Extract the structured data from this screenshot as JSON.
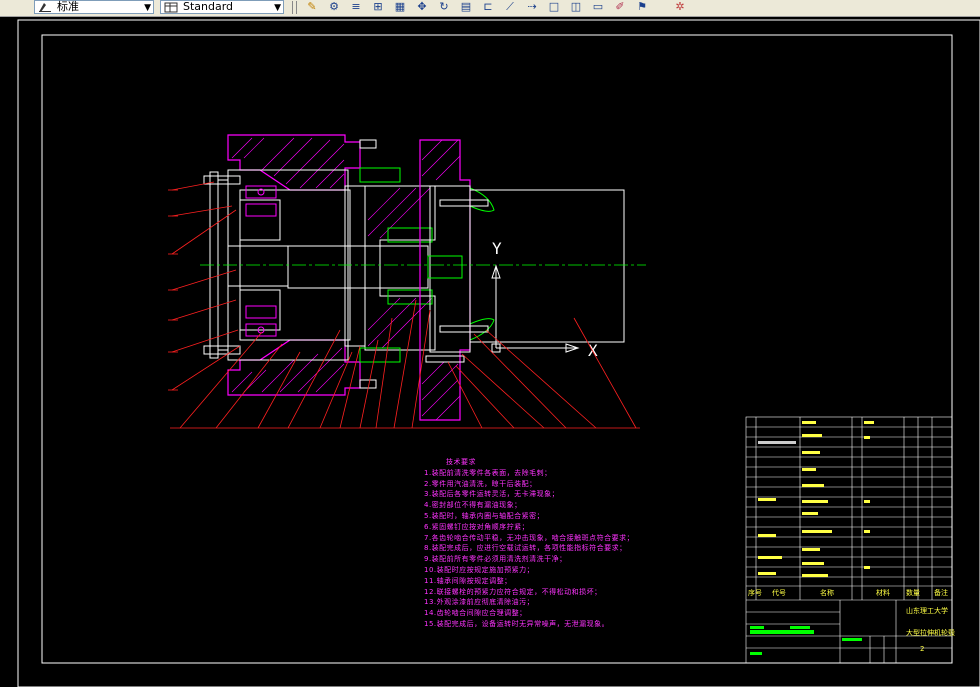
{
  "toolbar": {
    "style_combo": {
      "value": "标准"
    },
    "table_style_combo": {
      "value": "Standard"
    },
    "tools": [
      "pencil-icon",
      "node-icon",
      "layer-icon",
      "grid-icon",
      "move-icon",
      "rotate-icon",
      "table-icon",
      "dim-icon",
      "dim-icon",
      "rect-icon",
      "rect-icon",
      "edit-icon",
      "flag-icon",
      "explode-icon"
    ]
  },
  "drawing": {
    "axis_y_label": "Y",
    "axis_x_label": "X",
    "tech_requirements_title": "技术要求",
    "tech_requirements": [
      "1.装配前清洗零件各表面，去除毛刺；",
      "2.零件用汽油清洗，晾干后装配；",
      "3.装配后各零件运转灵活，无卡滞现象；",
      "4.密封部位不得有漏油现象；",
      "5.装配时，轴承内圈与轴配合紧密；",
      "6.紧固螺钉应按对角顺序拧紧；",
      "7.各齿轮啮合传动平稳，无冲击现象，啮合接触斑点符合要求；",
      "8.装配完成后，应进行空载试运转，各项性能指标符合要求；",
      "9.装配前所有零件必须用清洗剂清洗干净；",
      "10.装配时应按规定施加预紧力；",
      "11.轴承间隙按规定调整；",
      "12.联接螺栓的预紧力应符合规定，不得松动和损坏；",
      "13.外观涂漆前应彻底清除油污；",
      "14.齿轮啮合间隙应合理调整；",
      "15.装配完成后，设备运转时无异常噪声，无泄漏现象。"
    ],
    "title_block": {
      "school": "山东理工大学",
      "drawing_name": "大型拉伸机轮毂",
      "sheet_no": "2",
      "col_code": "代号",
      "col_name": "名称",
      "col_material": "材料",
      "col_qty": "数量",
      "col_seq": "序号",
      "col_note": "备注"
    }
  },
  "colors": {
    "outline": "#ffffff",
    "centerline": "#00ff00",
    "leader": "#ff0000",
    "flange": "#ff00ff",
    "bearing": "#ff00ff",
    "notes": "#ff33ff",
    "title_text": "#ffff44",
    "toolbar_bg": "#ece9d8"
  }
}
